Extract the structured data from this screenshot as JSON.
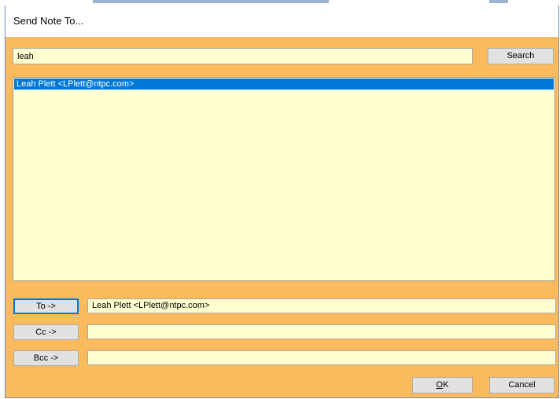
{
  "window": {
    "title": "Send Note To..."
  },
  "search": {
    "value": "leah",
    "button_label": "Search"
  },
  "results": [
    {
      "label": "Leah Plett <LPlett@ntpc.com>",
      "selected": true
    }
  ],
  "recipients": {
    "to": {
      "button_label": "To ->",
      "value": "Leah Plett <LPlett@ntpc.com>"
    },
    "cc": {
      "button_label": "Cc ->",
      "value": ""
    },
    "bcc": {
      "button_label": "Bcc ->",
      "value": ""
    }
  },
  "footer": {
    "ok_label": "OK",
    "cancel_label": "Cancel"
  },
  "colors": {
    "dialog_background": "#fbba5c",
    "field_background": "#ffffd0",
    "selection": "#0078d7"
  }
}
